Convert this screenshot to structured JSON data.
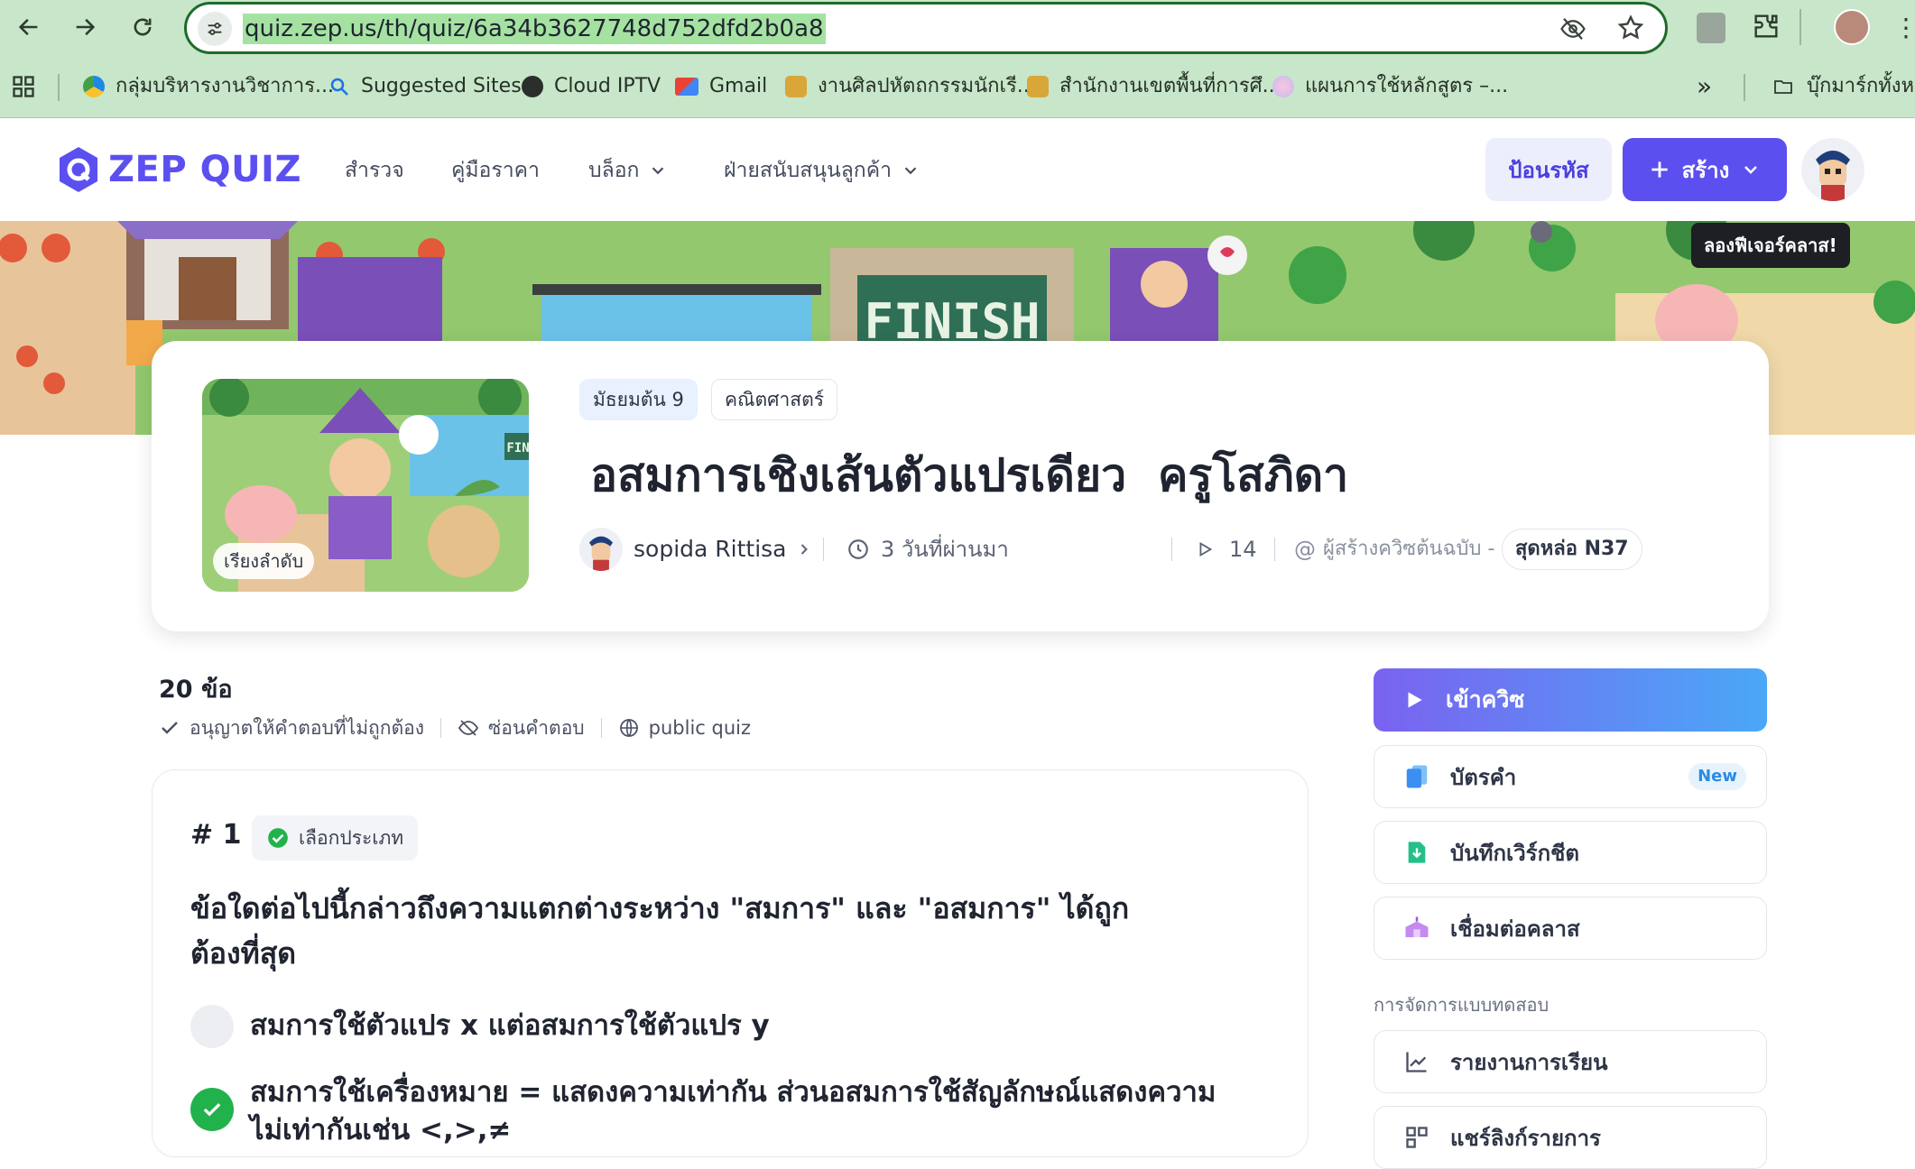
{
  "browser": {
    "url": "quiz.zep.us/th/quiz/6a34b3627748d752dfd2b0a8",
    "bookmarks": [
      {
        "label": "กลุ่มบริหารงานวิชาการ..."
      },
      {
        "label": "Suggested Sites"
      },
      {
        "label": "Cloud IPTV"
      },
      {
        "label": "Gmail"
      },
      {
        "label": "งานศิลปหัตถกรรมนักเรี..."
      },
      {
        "label": "สำนักงานเขตพื้นที่การศึ..."
      },
      {
        "label": "แผนการใช้หลักสูตร –..."
      }
    ],
    "more": "»",
    "all_bookmarks": "บุ๊กมาร์กทั้งหมด"
  },
  "header": {
    "logo_text": "ZEP QUIZ",
    "nav": [
      {
        "label": "สำรวจ"
      },
      {
        "label": "คู่มือราคา"
      },
      {
        "label": "บล็อก"
      },
      {
        "label": "ฝ่ายสนับสนุนลูกค้า"
      }
    ],
    "enter_code": "ป้อนรหัส",
    "create": "สร้าง",
    "tooltip": "ลองฟีเจอร์คลาส!"
  },
  "banner": {
    "sign_text": "FINISH"
  },
  "quiz": {
    "tags": [
      "มัธยมต้น 9",
      "คณิตศาสตร์"
    ],
    "title": "อสมการเชิงเส้นตัวแปรเดียว  ครูโสภิดา",
    "thumb_badge": "เรียงลำดับ",
    "thumb_sign": "FIN",
    "author": "sopida Rittisa",
    "time_ago": "3 วันที่ผ่านมา",
    "plays": "14",
    "original_creator_label": "ผู้สร้างควิซต้นฉบับ -",
    "original_creator": "สุดหล่อ N37"
  },
  "summary": {
    "count": "20 ข้อ",
    "options": [
      {
        "label": "อนุญาตให้คำตอบที่ไม่ถูกต้อง"
      },
      {
        "label": "ซ่อนคำตอบ"
      },
      {
        "label": "public quiz"
      }
    ]
  },
  "question": {
    "number": "# 1",
    "type": "เลือกประเภท",
    "text_line1": "ข้อใดต่อไปนี้กล่าวถึงความแตกต่างระหว่าง \"สมการ\" และ \"อสมการ\" ได้ถูก",
    "text_line2": "ต้องที่สุด",
    "options": [
      {
        "text": "สมการใช้ตัวแปร x แต่อสมการใช้ตัวแปร y",
        "correct": false
      },
      {
        "text_line1": "สมการใช้เครื่องหมาย = แสดงความเท่ากัน ส่วนอสมการใช้สัญลักษณ์แสดงความ",
        "text_line2": "ไม่เท่ากันเช่น <,>,≠",
        "correct": true
      }
    ]
  },
  "sidebar": {
    "start_quiz": "เข้าควิซ",
    "flashcard": "บัตรคำ",
    "flashcard_badge": "New",
    "worksheet": "บันทึกเวิร์กชีต",
    "connect_class": "เชื่อมต่อคลาส",
    "section_title": "การจัดการแบบทดสอบ",
    "report": "รายงานการเรียน",
    "share_list": "แชร์ลิงก์รายการ"
  },
  "colors": {
    "primary": "#5b4ff0",
    "chrome_bg": "#c8e6c9",
    "url_highlight": "#a5e2a2",
    "correct_green": "#22b24c",
    "start_gradient_from": "#7a62f0",
    "start_gradient_to": "#4aa8f7"
  }
}
